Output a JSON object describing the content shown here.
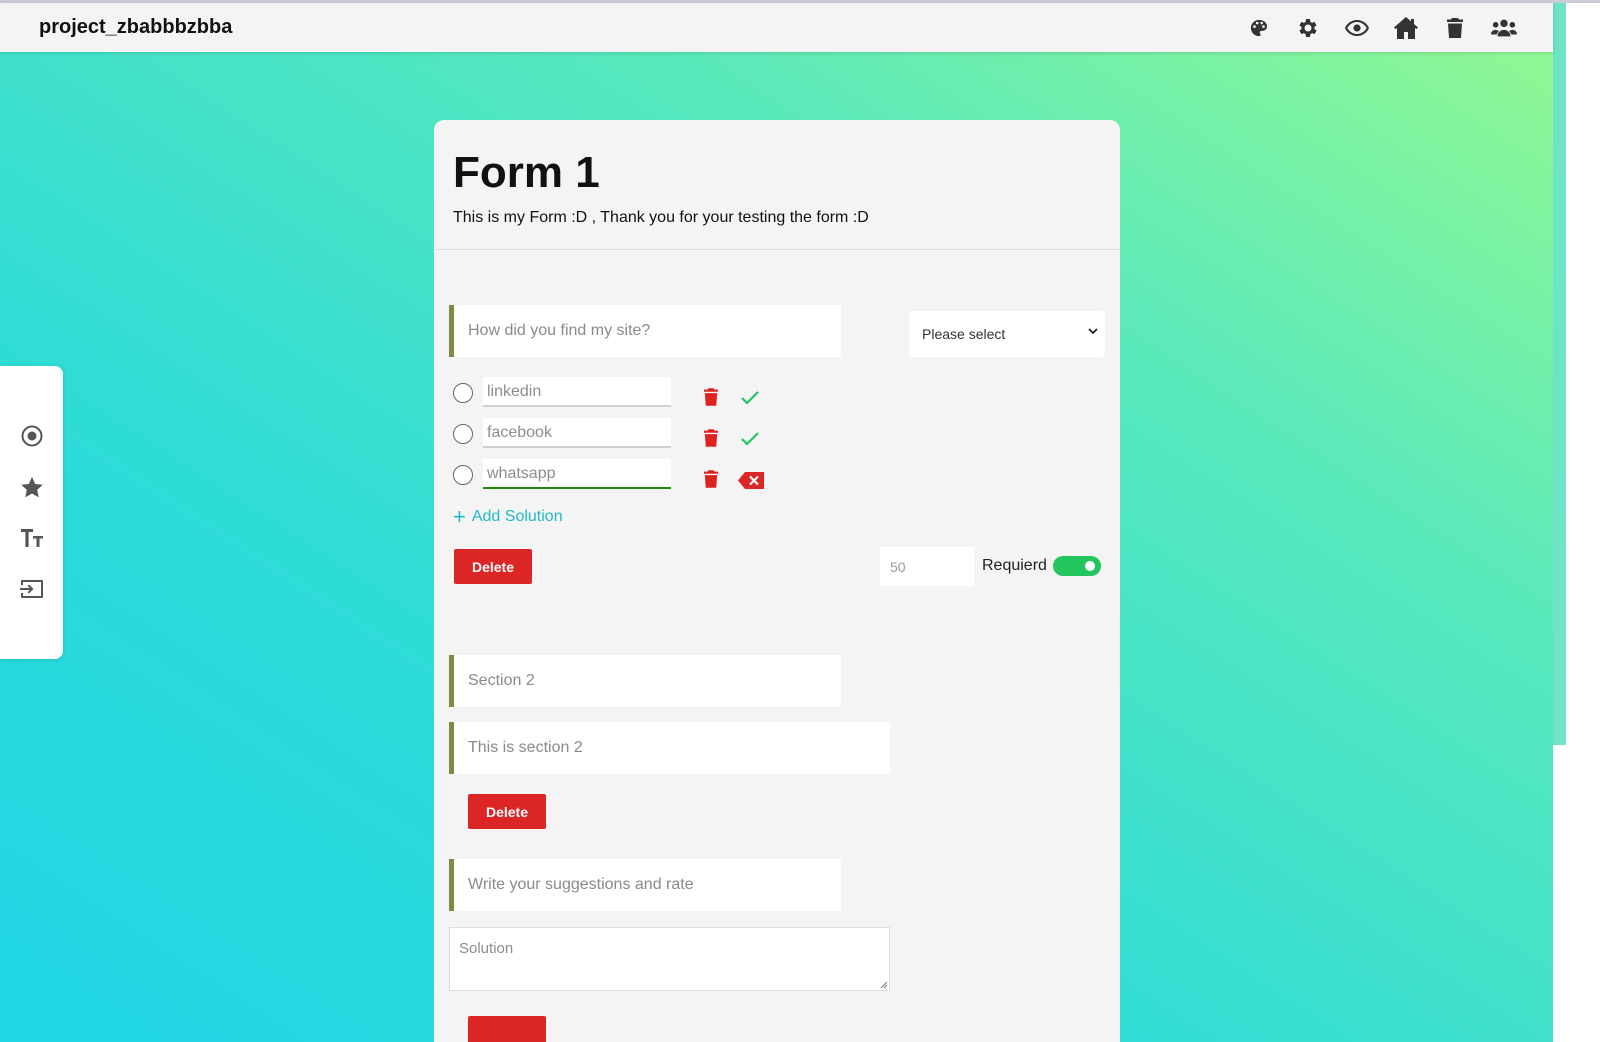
{
  "app": {
    "brand": "project_zbabbbzbba"
  },
  "nav_icons": [
    "palette-icon",
    "gear-icon",
    "eye-icon",
    "home-icon",
    "trash-icon",
    "users-icon"
  ],
  "sidebar_tools": [
    "radio-icon",
    "star-icon",
    "text-size-icon",
    "input-icon"
  ],
  "form": {
    "title": "Form 1",
    "description": "This is my Form :D , Thank you for your testing the form :D"
  },
  "question1": {
    "placeholder": "How did you find my site?",
    "type_select": "Please select",
    "options": [
      {
        "value": "linkedin",
        "status": "check"
      },
      {
        "value": "facebook",
        "status": "check"
      },
      {
        "value": "whatsapp",
        "status": "remove"
      }
    ],
    "add_solution": "Add Solution",
    "delete_label": "Delete",
    "limit_value": "50",
    "required_label": "Requierd",
    "required_on": true
  },
  "section2": {
    "title_placeholder": "Section 2",
    "desc_placeholder": "This is section 2",
    "delete_label": "Delete"
  },
  "question3": {
    "placeholder": "Write your suggestions and rate",
    "answer_placeholder": "Solution"
  },
  "colors": {
    "accent_border": "#7c8c47",
    "danger": "#dc2626",
    "success": "#22c55e",
    "link": "#1fb9c9"
  }
}
